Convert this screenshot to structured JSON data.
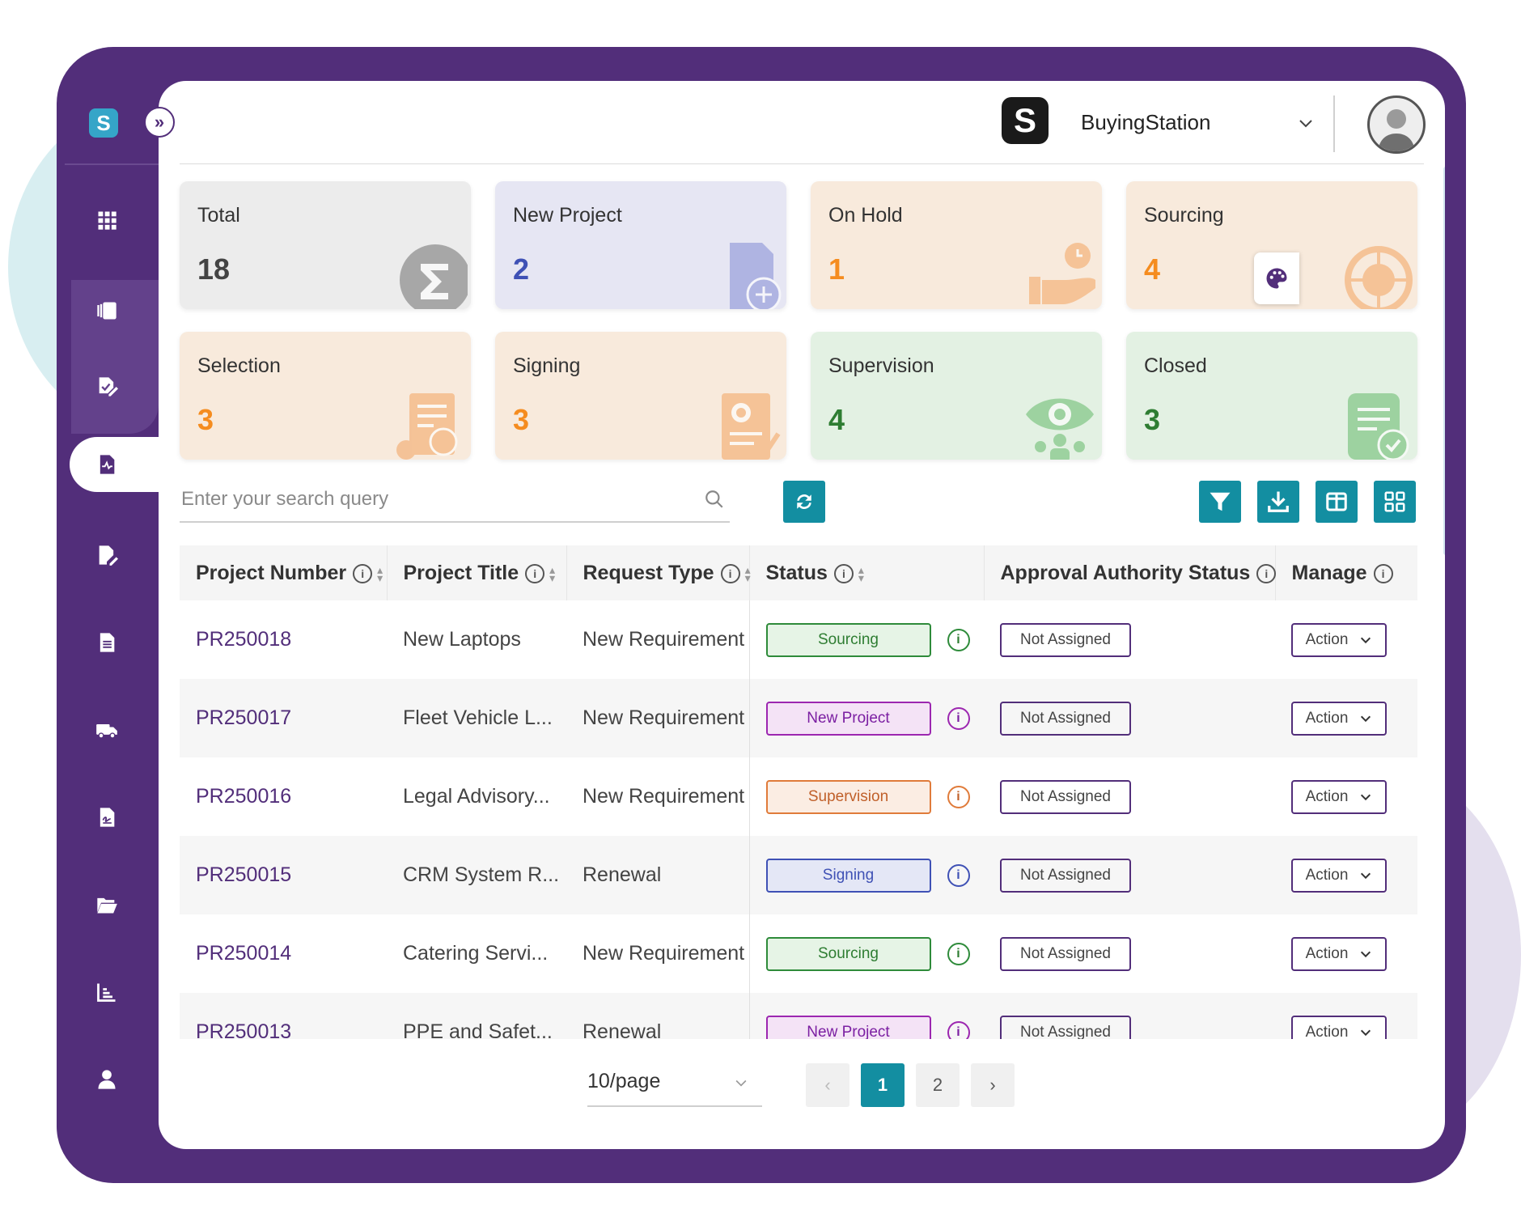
{
  "brand": {
    "name": "BuyingStation",
    "logo_glyph": "S"
  },
  "sidebar": {
    "logo_glyph": "S",
    "collapse_glyph": "»",
    "items": [
      {
        "icon": "apps-grid-icon"
      },
      {
        "icon": "dashboard-panel-icon"
      },
      {
        "icon": "edit-document-icon"
      },
      {
        "icon": "pulse-document-icon"
      },
      {
        "icon": "file-edit-icon"
      },
      {
        "icon": "file-text-icon"
      },
      {
        "icon": "truck-icon"
      },
      {
        "icon": "signature-document-icon"
      },
      {
        "icon": "folder-open-icon"
      },
      {
        "icon": "chart-icon"
      },
      {
        "icon": "user-icon"
      }
    ]
  },
  "cards": [
    {
      "label": "Total",
      "value": "18",
      "value_color": "#444444",
      "bg": "#ececec",
      "icon": "sigma-icon"
    },
    {
      "label": "New Project",
      "value": "2",
      "value_color": "#3f51b5",
      "bg": "#e6e6f3",
      "icon": "new-file-icon"
    },
    {
      "label": "On Hold",
      "value": "1",
      "value_color": "#f58c1f",
      "bg": "#f8eadc",
      "icon": "hand-clock-icon"
    },
    {
      "label": "Sourcing",
      "value": "4",
      "value_color": "#f58c1f",
      "bg": "#f8eadc",
      "icon": "globe-search-icon"
    },
    {
      "label": "Selection",
      "value": "3",
      "value_color": "#f58c1f",
      "bg": "#f8eadc",
      "icon": "selection-doc-icon"
    },
    {
      "label": "Signing",
      "value": "3",
      "value_color": "#f58c1f",
      "bg": "#f8eadc",
      "icon": "contract-gear-icon"
    },
    {
      "label": "Supervision",
      "value": "4",
      "value_color": "#2e7d32",
      "bg": "#e3f1e3",
      "icon": "eye-people-icon"
    },
    {
      "label": "Closed",
      "value": "3",
      "value_color": "#2e7d32",
      "bg": "#e3f1e3",
      "icon": "doc-check-icon"
    }
  ],
  "search": {
    "placeholder": "Enter your search query"
  },
  "toolbar": {
    "refresh": "refresh-icon",
    "filter": "filter-icon",
    "download": "download-icon",
    "columns": "columns-icon",
    "grid": "grid-view-icon",
    "accent": "#138ea1"
  },
  "table": {
    "columns": [
      "Project Number",
      "Project Title",
      "Request Type",
      "Status",
      "Approval Authority Status",
      "Manage"
    ],
    "rows": [
      {
        "number": "PR250018",
        "title": "New Laptops",
        "type": "New Requirement",
        "status": "Sourcing",
        "approval": "Not Assigned",
        "action": "Action"
      },
      {
        "number": "PR250017",
        "title": "Fleet Vehicle L...",
        "type": "New Requirement",
        "status": "New Project",
        "approval": "Not Assigned",
        "action": "Action"
      },
      {
        "number": "PR250016",
        "title": "Legal Advisory...",
        "type": "New Requirement",
        "status": "Supervision",
        "approval": "Not Assigned",
        "action": "Action"
      },
      {
        "number": "PR250015",
        "title": "CRM System R...",
        "type": "Renewal",
        "status": "Signing",
        "approval": "Not Assigned",
        "action": "Action"
      },
      {
        "number": "PR250014",
        "title": "Catering Servi...",
        "type": "New Requirement",
        "status": "Sourcing",
        "approval": "Not Assigned",
        "action": "Action"
      },
      {
        "number": "PR250013",
        "title": "PPE and Safet...",
        "type": "Renewal",
        "status": "New Project",
        "approval": "Not Assigned",
        "action": "Action"
      }
    ]
  },
  "status_colors": {
    "Sourcing": {
      "border": "#2e8b3a",
      "bg": "#e6f4e6",
      "text": "#2e7d32"
    },
    "New Project": {
      "border": "#9c27b0",
      "bg": "#f4e3f6",
      "text": "#7b1fa2"
    },
    "Supervision": {
      "border": "#e07b3a",
      "bg": "#fbede3",
      "text": "#c0602a"
    },
    "Signing": {
      "border": "#3f51b5",
      "bg": "#e4e7f6",
      "text": "#3f51b5"
    }
  },
  "pagination": {
    "page_size": "10/page",
    "prev": "‹",
    "next": "›",
    "pages": [
      "1",
      "2"
    ],
    "current": "1"
  }
}
